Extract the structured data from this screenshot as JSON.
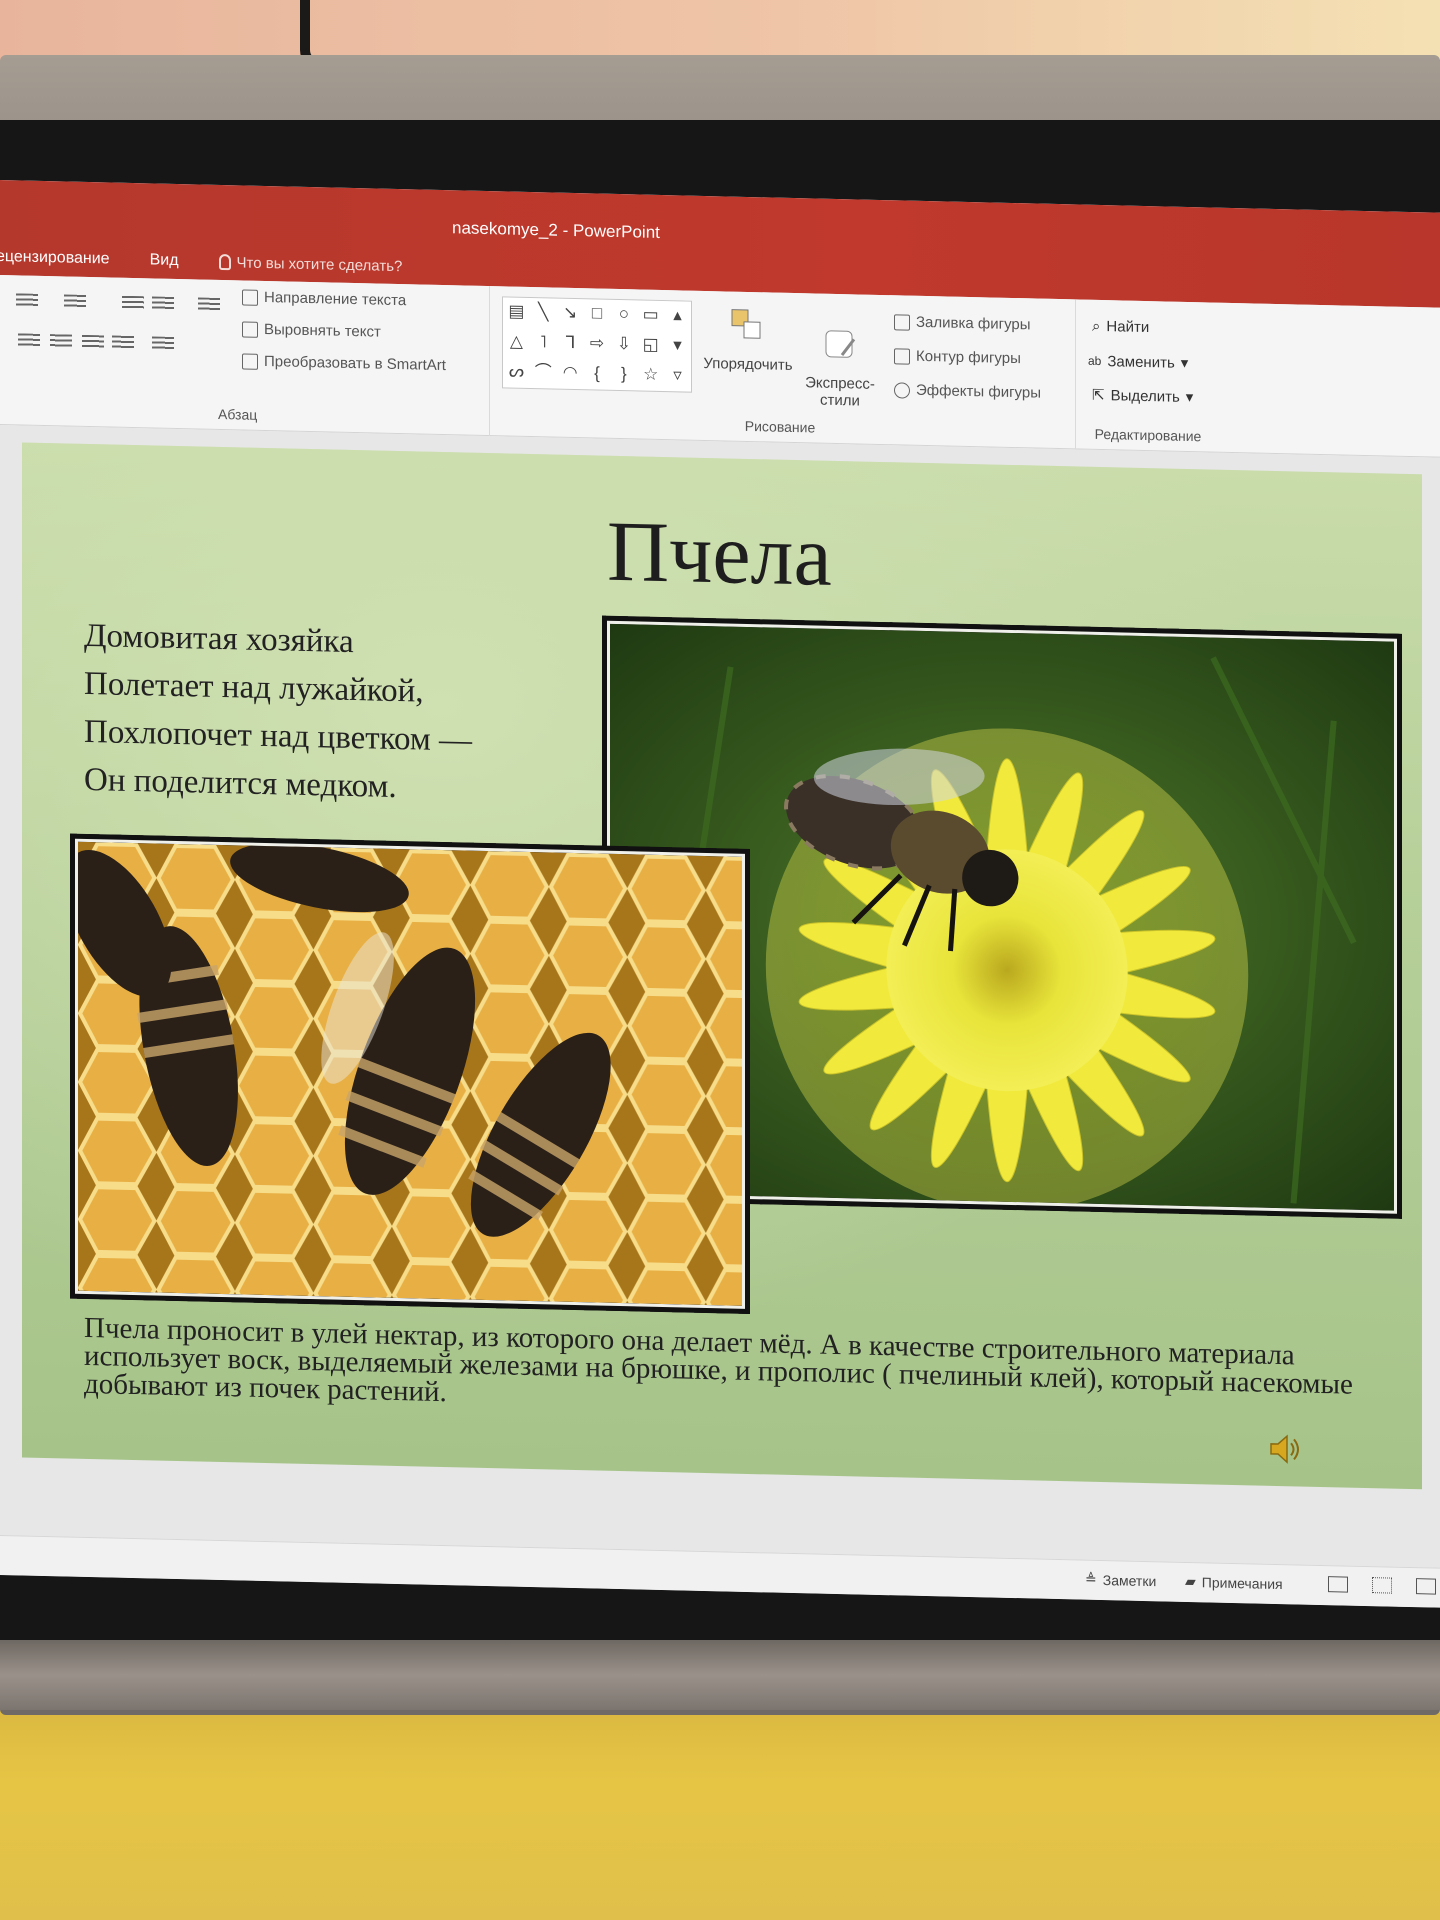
{
  "window": {
    "title": "nasekomye_2 - PowerPoint"
  },
  "tabs": [
    {
      "label": "ецензирование"
    },
    {
      "label": "Вид"
    }
  ],
  "tell_me": {
    "placeholder": "Что вы хотите сделать?"
  },
  "ribbon": {
    "paragraph": {
      "label": "Абзац",
      "text_direction": "Направление текста",
      "align_text": "Выровнять текст",
      "smartart": "Преобразовать в SmartArt"
    },
    "drawing": {
      "label": "Рисование",
      "arrange": "Упорядочить",
      "quick_styles": "Экспресс-\nстили",
      "shape_fill": "Заливка фигуры",
      "shape_outline": "Контур фигуры",
      "shape_effects": "Эффекты фигуры"
    },
    "editing": {
      "label": "Редактирование",
      "find": "Найти",
      "replace": "Заменить",
      "select": "Выделить"
    }
  },
  "slide": {
    "title": "Пчела",
    "poem": [
      "Домовитая хозяйка",
      "Полетает над лужайкой,",
      "Похлопочет над цветком —",
      "Он поделится медком."
    ],
    "description": "Пчела проносит в улей нектар, из которого она делает мёд. А в качестве строительного материала использует воск, выделяемый железами на брюшке, и прополис  ( пчелиный клей), который насекомые добывают из почек растений."
  },
  "statusbar": {
    "notes": "Заметки",
    "comments": "Примечания"
  }
}
